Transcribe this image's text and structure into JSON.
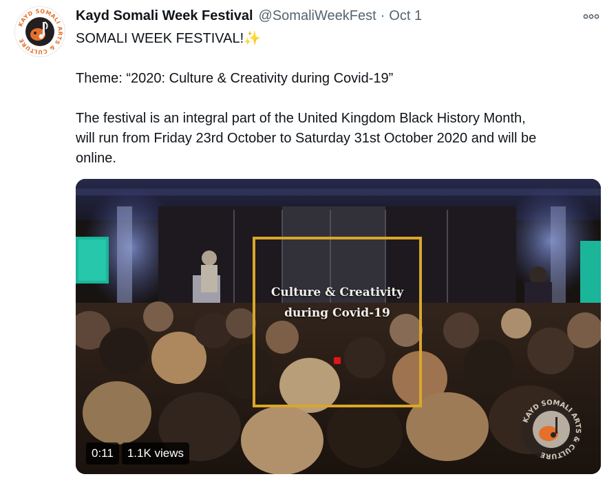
{
  "tweet": {
    "author_name": "Kayd Somali Week Festival",
    "handle": "@SomaliWeekFest",
    "separator": "·",
    "date": "Oct 1",
    "lines": [
      "SOMALI WEEK FESTIVAL!✨",
      "Theme: “2020: Culture & Creativity during Covid-19”",
      "The festival is an integral part of the United Kingdom Black History Month,",
      "will run from Friday 23rd October to Saturday 31st October 2020 and will be",
      "online."
    ],
    "more_icon": "more-horizontal-icon"
  },
  "avatar": {
    "ring_text": "KAYD SOMALI ARTS & CULTURE",
    "colors": {
      "brand_orange": "#e4702a",
      "dark": "#231f20"
    }
  },
  "video": {
    "overlay_line1": "Culture & Creativity",
    "overlay_line2": "during Covid-19",
    "duration": "0:11",
    "views": "1.1K views",
    "watermark_text": "KAYD SOMALI ARTS & CULTURE",
    "colors": {
      "frame": "#d9a72a",
      "rec": "#e3141a"
    }
  }
}
